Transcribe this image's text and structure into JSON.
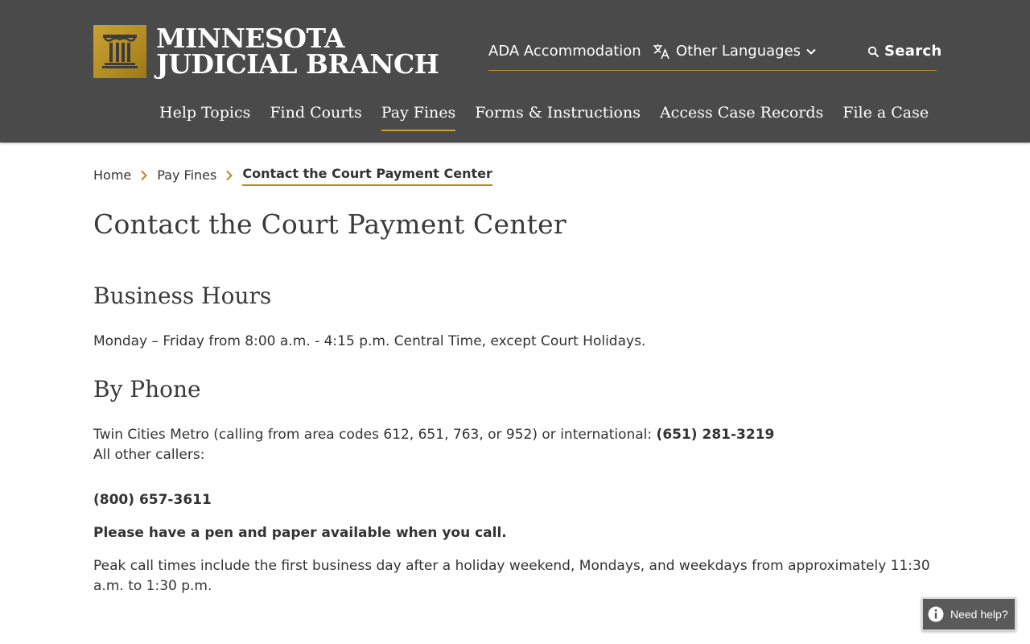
{
  "header": {
    "logo": {
      "line1": "MINNESOTA",
      "line2": "JUDICIAL BRANCH",
      "icon": "courthouse-pillar-icon",
      "color": "#b38b22"
    },
    "utility": {
      "ada_label": "ADA Accommodation",
      "languages_label": "Other Languages",
      "languages_icon": "translate-icon",
      "search_label": "Search",
      "search_icon": "search-icon"
    },
    "nav": {
      "items": [
        {
          "label": "Help Topics"
        },
        {
          "label": "Find Courts"
        },
        {
          "label": "Pay Fines",
          "active": true
        },
        {
          "label": "Forms & Instructions"
        },
        {
          "label": "Access Case Records"
        },
        {
          "label": "File a Case"
        }
      ]
    },
    "background": "#4a4a4a",
    "accent": "#b38b22"
  },
  "breadcrumb": {
    "items": [
      {
        "label": "Home"
      },
      {
        "label": "Pay Fines"
      },
      {
        "label": "Contact the Court Payment Center",
        "current": true
      }
    ]
  },
  "main": {
    "title": "Contact the Court Payment Center",
    "hours": {
      "heading": "Business Hours",
      "text": "Monday – Friday from 8:00 a.m. - 4:15 p.m. Central Time, except Court Holidays."
    },
    "phone": {
      "heading": "By Phone",
      "metro_text": "Twin Cities Metro (calling from area codes 612, 651, 763, or 952) or international: ",
      "metro_number": "(651) 281-3219",
      "other_text": "All other callers:",
      "toll_free": "(800) 657-3611",
      "pen_note": "Please have a pen and paper available when you call.",
      "peak_text": "Peak call times include the first business day after a holiday weekend, Mondays, and weekdays from approximately 11:30 a.m. to 1:30 p.m."
    }
  },
  "help_widget": {
    "label": "Need help?",
    "icon": "info-icon"
  }
}
